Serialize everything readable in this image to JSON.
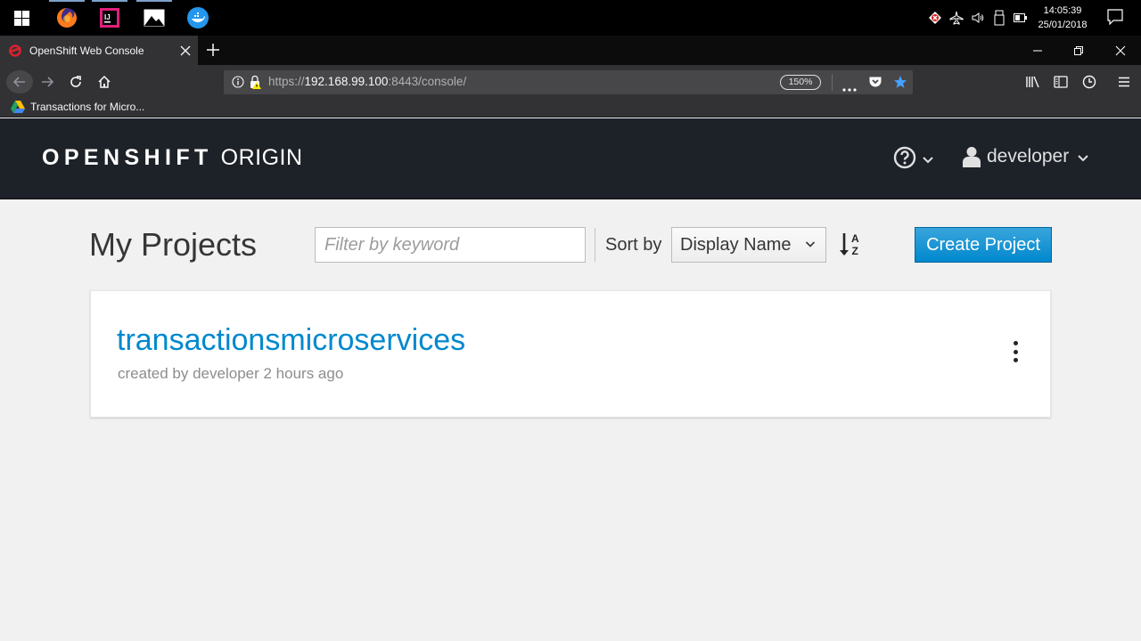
{
  "taskbar": {
    "time": "14:05:39",
    "date": "25/01/2018",
    "apps": [
      "firefox",
      "intellij",
      "photos",
      "docker"
    ]
  },
  "browser": {
    "tab_title": "OpenShift Web Console",
    "url_prefix": "https://",
    "url_host": "192.168.99.100",
    "url_rest": ":8443/console/",
    "zoom": "150%",
    "bookmark": "Transactions for Micro..."
  },
  "header": {
    "brand_bold": "OPENSHIFT",
    "brand_light": "ORIGIN",
    "username": "developer"
  },
  "toolbar": {
    "page_title": "My Projects",
    "filter_placeholder": "Filter by keyword",
    "sort_label": "Sort by",
    "sort_value": "Display Name",
    "create_button": "Create Project"
  },
  "projects": [
    {
      "name": "transactionsmicroservices",
      "meta": "created by developer 2 hours ago"
    }
  ],
  "colors": {
    "accent": "#0088ce",
    "header_bg": "#1d2128",
    "page_bg": "#f1f1f1"
  }
}
